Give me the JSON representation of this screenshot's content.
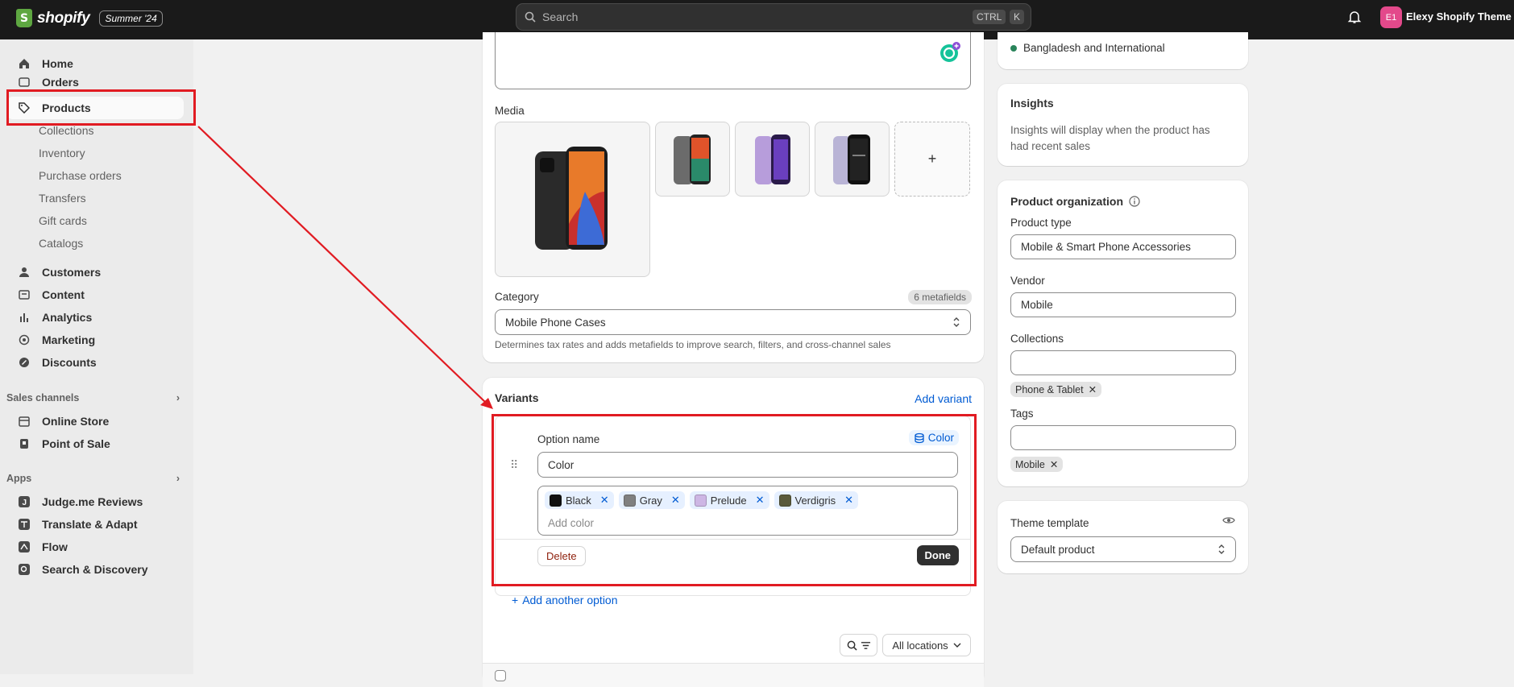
{
  "topbar": {
    "brand": "shopify",
    "brand_letter": "S",
    "edition": "Summer '24",
    "search_placeholder": "Search",
    "kbd1": "CTRL",
    "kbd2": "K",
    "avatar_initials": "E1",
    "store_name": "Elexy Shopify Theme (F"
  },
  "sidebar": {
    "items": [
      {
        "label": "Home",
        "icon": "home-icon"
      },
      {
        "label": "Orders",
        "icon": "inbox-icon"
      },
      {
        "label": "Products",
        "icon": "tag-icon"
      },
      {
        "label": "Collections"
      },
      {
        "label": "Inventory"
      },
      {
        "label": "Purchase orders"
      },
      {
        "label": "Transfers"
      },
      {
        "label": "Gift cards"
      },
      {
        "label": "Catalogs"
      },
      {
        "label": "Customers",
        "icon": "person-icon"
      },
      {
        "label": "Content",
        "icon": "content-icon"
      },
      {
        "label": "Analytics",
        "icon": "bar-chart-icon"
      },
      {
        "label": "Marketing",
        "icon": "target-icon"
      },
      {
        "label": "Discounts",
        "icon": "discount-icon"
      }
    ],
    "sales_channels_label": "Sales channels",
    "channels": [
      {
        "label": "Online Store",
        "icon": "store-icon"
      },
      {
        "label": "Point of Sale",
        "icon": "pos-icon"
      }
    ],
    "apps_label": "Apps",
    "apps": [
      {
        "label": "Judge.me Reviews",
        "icon": "judgeme-icon"
      },
      {
        "label": "Translate & Adapt",
        "icon": "translate-icon"
      },
      {
        "label": "Flow",
        "icon": "flow-icon"
      },
      {
        "label": "Search & Discovery",
        "icon": "search-discovery-icon"
      }
    ]
  },
  "main": {
    "media_label": "Media",
    "add_media": "+",
    "category_label": "Category",
    "metafields_badge": "6 metafields",
    "category_value": "Mobile Phone Cases",
    "category_help": "Determines tax rates and adds metafields to improve search, filters, and cross-channel sales",
    "variants_title": "Variants",
    "add_variant": "Add variant",
    "option_name_label": "Option name",
    "option_badge": "Color",
    "option_name_value": "Color",
    "colors": [
      {
        "name": "Black",
        "hex": "#111111"
      },
      {
        "name": "Gray",
        "hex": "#808080"
      },
      {
        "name": "Prelude",
        "hex": "#cdb6e4"
      },
      {
        "name": "Verdigris",
        "hex": "#5a5a3a"
      }
    ],
    "add_color_placeholder": "Add color",
    "delete_label": "Delete",
    "done_label": "Done",
    "add_another_option": "Add another option",
    "all_locations": "All locations"
  },
  "right": {
    "market_text": "Bangladesh and International",
    "insights_title": "Insights",
    "insights_text": "Insights will display when the product has had recent sales",
    "org_title": "Product organization",
    "product_type_label": "Product type",
    "product_type_value": "Mobile & Smart Phone Accessories",
    "vendor_label": "Vendor",
    "vendor_value": "Mobile",
    "collections_label": "Collections",
    "collection_chip": "Phone & Tablet",
    "tags_label": "Tags",
    "tag_chip": "Mobile",
    "theme_label": "Theme template",
    "theme_value": "Default product"
  },
  "colors": {
    "accent": "#005bd3",
    "highlight": "#e11b22",
    "topbar": "#1a1a1a"
  }
}
